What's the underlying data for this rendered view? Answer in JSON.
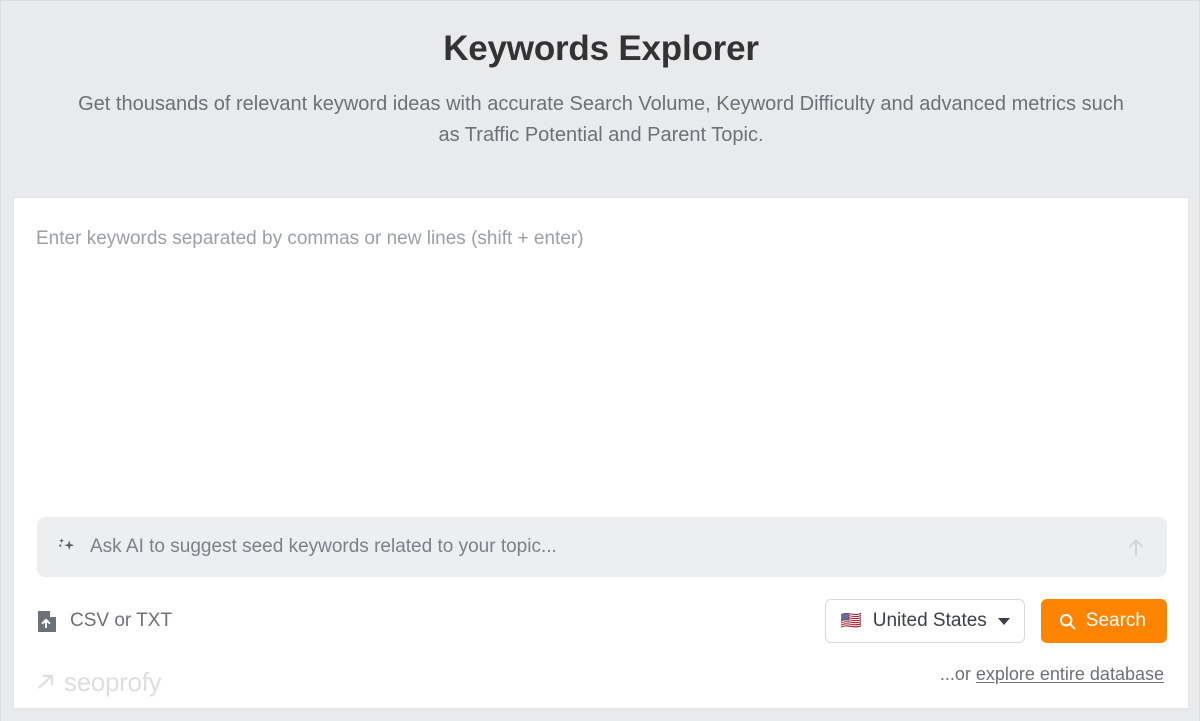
{
  "header": {
    "title": "Keywords Explorer",
    "subtitle": "Get thousands of relevant keyword ideas with accurate Search Volume, Keyword Difficulty and advanced metrics such as Traffic Potential and Parent Topic."
  },
  "keyword_input": {
    "placeholder": "Enter keywords separated by commas or new lines (shift + enter)",
    "value": ""
  },
  "ai_bar": {
    "icon": "sparkle-icon",
    "placeholder": "Ask AI to suggest seed keywords related to your topic...",
    "submit_icon": "arrow-up-icon"
  },
  "upload": {
    "icon": "file-upload-icon",
    "label": "CSV or TXT"
  },
  "country": {
    "flag": "🇺🇸",
    "name": "United States",
    "caret_icon": "chevron-down-icon"
  },
  "search": {
    "icon": "search-icon",
    "label": "Search"
  },
  "explore": {
    "prefix": "...or ",
    "link": "explore entire database"
  },
  "watermark": {
    "icon": "arrow-up-right-icon",
    "text": "seoprofy"
  },
  "colors": {
    "accent": "#ff8400",
    "page_background": "#e9eaec",
    "card_background": "#ffffff",
    "ai_bar_background": "#eceef0",
    "title": "#333333",
    "muted_text": "#6b7177",
    "placeholder_text": "#9aa0a6",
    "watermark": "#dcdee0"
  }
}
